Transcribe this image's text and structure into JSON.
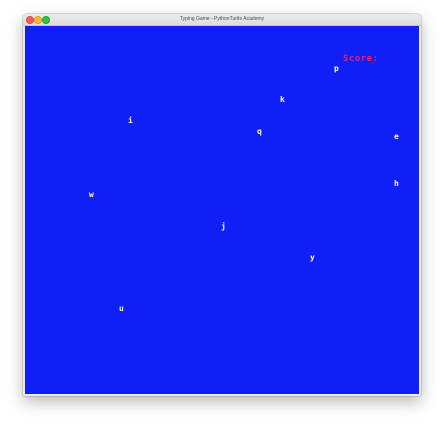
{
  "window": {
    "title": "Typing Game - PythonTurtle Academy"
  },
  "game": {
    "background_color": "#0f1ff5",
    "score_label": "Score:",
    "score_color": "#e8206a",
    "letter_color": "#ffffff",
    "letters": [
      "p",
      "k",
      "i",
      "q",
      "e",
      "h",
      "w",
      "j",
      "y",
      "u"
    ]
  }
}
